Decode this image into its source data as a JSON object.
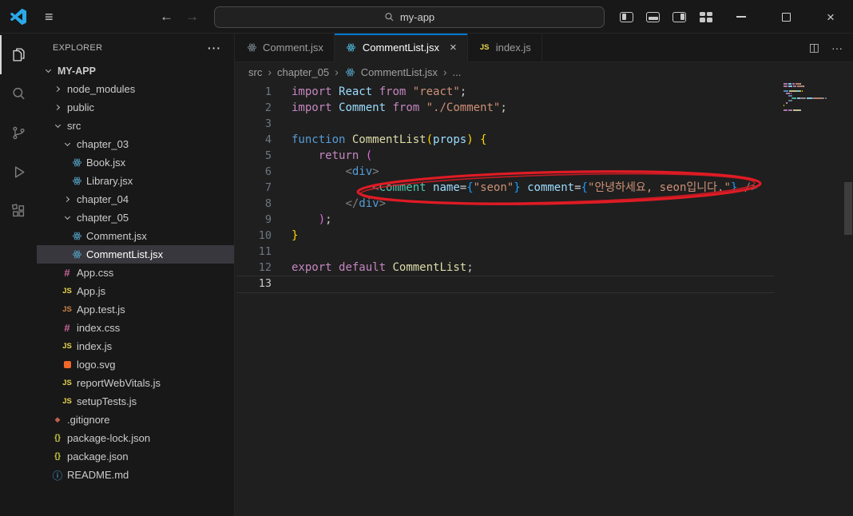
{
  "titlebar": {
    "search": "my-app"
  },
  "icons": {
    "menu": "≡",
    "back": "←",
    "forward": "→",
    "more": "···",
    "split": "◫",
    "close_tab": "×",
    "window_close": "×",
    "crumb_sep": "›"
  },
  "activity_bar": {
    "items": [
      {
        "name": "explorer",
        "active": true
      },
      {
        "name": "search",
        "active": false
      },
      {
        "name": "source-control",
        "active": false
      },
      {
        "name": "run-debug",
        "active": false
      },
      {
        "name": "extensions",
        "active": false
      }
    ]
  },
  "explorer": {
    "title": "EXPLORER",
    "root": {
      "label": "MY-APP",
      "expanded": true
    },
    "tree": [
      {
        "label": "node_modules",
        "type": "folder",
        "indent": 1,
        "expanded": false
      },
      {
        "label": "public",
        "type": "folder",
        "indent": 1,
        "expanded": false
      },
      {
        "label": "src",
        "type": "folder",
        "indent": 1,
        "expanded": true
      },
      {
        "label": "chapter_03",
        "type": "folder",
        "indent": 2,
        "expanded": true
      },
      {
        "label": "Book.jsx",
        "type": "react",
        "indent": 3
      },
      {
        "label": "Library.jsx",
        "type": "react",
        "indent": 3
      },
      {
        "label": "chapter_04",
        "type": "folder",
        "indent": 2,
        "expanded": false
      },
      {
        "label": "chapter_05",
        "type": "folder",
        "indent": 2,
        "expanded": true
      },
      {
        "label": "Comment.jsx",
        "type": "react",
        "indent": 3
      },
      {
        "label": "CommentList.jsx",
        "type": "react",
        "indent": 3,
        "selected": true
      },
      {
        "label": "App.css",
        "type": "css",
        "indent": 2
      },
      {
        "label": "App.js",
        "type": "js",
        "indent": 2
      },
      {
        "label": "App.test.js",
        "type": "jstest",
        "indent": 2
      },
      {
        "label": "index.css",
        "type": "css",
        "indent": 2
      },
      {
        "label": "index.js",
        "type": "js",
        "indent": 2
      },
      {
        "label": "logo.svg",
        "type": "svg",
        "indent": 2
      },
      {
        "label": "reportWebVitals.js",
        "type": "js",
        "indent": 2
      },
      {
        "label": "setupTests.js",
        "type": "js",
        "indent": 2
      },
      {
        "label": ".gitignore",
        "type": "git",
        "indent": 1
      },
      {
        "label": "package-lock.json",
        "type": "json",
        "indent": 1
      },
      {
        "label": "package.json",
        "type": "json",
        "indent": 1
      },
      {
        "label": "README.md",
        "type": "info",
        "indent": 1
      }
    ]
  },
  "editor": {
    "tabs": [
      {
        "label": "Comment.jsx",
        "icon": "react",
        "active": false
      },
      {
        "label": "CommentList.jsx",
        "icon": "react",
        "active": true
      },
      {
        "label": "index.js",
        "icon": "js",
        "active": false
      }
    ],
    "breadcrumbs": [
      {
        "label": "src"
      },
      {
        "label": "chapter_05"
      },
      {
        "label": "CommentList.jsx",
        "icon": "react"
      },
      {
        "label": "..."
      }
    ],
    "code": {
      "current_line": 13,
      "lines": [
        [
          [
            "kw",
            "import"
          ],
          [
            "pln",
            " "
          ],
          [
            "var",
            "React"
          ],
          [
            "pln",
            " "
          ],
          [
            "kw",
            "from"
          ],
          [
            "pln",
            " "
          ],
          [
            "str",
            "\"react\""
          ],
          [
            "pln",
            ";"
          ]
        ],
        [
          [
            "kw",
            "import"
          ],
          [
            "pln",
            " "
          ],
          [
            "var",
            "Comment"
          ],
          [
            "pln",
            " "
          ],
          [
            "kw",
            "from"
          ],
          [
            "pln",
            " "
          ],
          [
            "str",
            "\"./Comment\""
          ],
          [
            "pln",
            ";"
          ]
        ],
        [],
        [
          [
            "kw2",
            "function"
          ],
          [
            "pln",
            " "
          ],
          [
            "fn",
            "CommentList"
          ],
          [
            "b1",
            "("
          ],
          [
            "var",
            "props"
          ],
          [
            "b1",
            ")"
          ],
          [
            "pln",
            " "
          ],
          [
            "b1",
            "{"
          ]
        ],
        [
          [
            "pln",
            "    "
          ],
          [
            "kw",
            "return"
          ],
          [
            "pln",
            " "
          ],
          [
            "b2",
            "("
          ]
        ],
        [
          [
            "pln",
            "        "
          ],
          [
            "ang",
            "<"
          ],
          [
            "tag",
            "div"
          ],
          [
            "ang",
            ">"
          ]
        ],
        [
          [
            "pln",
            "            "
          ],
          [
            "ang",
            "<"
          ],
          [
            "cmp",
            "Comment"
          ],
          [
            "pln",
            " "
          ],
          [
            "attr",
            "name"
          ],
          [
            "pln",
            "="
          ],
          [
            "b3",
            "{"
          ],
          [
            "str",
            "\"seon\""
          ],
          [
            "b3",
            "}"
          ],
          [
            "pln",
            " "
          ],
          [
            "attr",
            "comment"
          ],
          [
            "pln",
            "="
          ],
          [
            "b3",
            "{"
          ],
          [
            "str",
            "\"안녕하세요, seon입니다.\""
          ],
          [
            "b3",
            "}"
          ],
          [
            "pln",
            " "
          ],
          [
            "ang",
            "/>"
          ]
        ],
        [
          [
            "pln",
            "        "
          ],
          [
            "ang",
            "</"
          ],
          [
            "tag",
            "div"
          ],
          [
            "ang",
            ">"
          ]
        ],
        [
          [
            "pln",
            "    "
          ],
          [
            "b2",
            ")"
          ],
          [
            "pln",
            ";"
          ]
        ],
        [
          [
            "b1",
            "}"
          ]
        ],
        [],
        [
          [
            "kw",
            "export"
          ],
          [
            "pln",
            " "
          ],
          [
            "kw",
            "default"
          ],
          [
            "pln",
            " "
          ],
          [
            "fn",
            "CommentList"
          ],
          [
            "pln",
            ";"
          ]
        ],
        []
      ]
    }
  },
  "colors": {
    "accent": "#0078d4",
    "annotation": "#e01b24",
    "selected_row": "#37373d",
    "syntax": {
      "kw": "#C586C0",
      "kw2": "#569CD6",
      "fn": "#DCDCAA",
      "var": "#9CDCFE",
      "str": "#CE9178",
      "pln": "#cccccc",
      "ang": "#808080",
      "tag": "#569CD6",
      "cmp": "#4EC9B0",
      "attr": "#9CDCFE",
      "b1": "#FFD700",
      "b2": "#DA70D6",
      "b3": "#179FFF"
    }
  }
}
